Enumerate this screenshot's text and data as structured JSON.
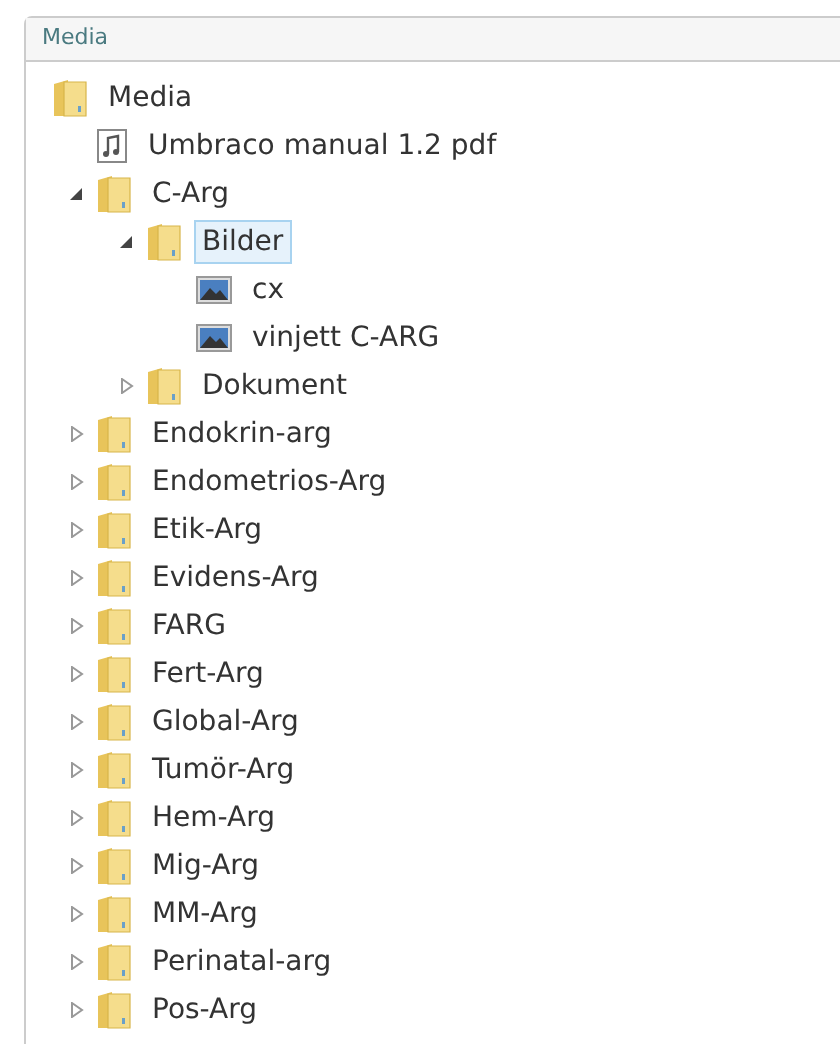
{
  "panel": {
    "title": "Media"
  },
  "tree": [
    {
      "label": "Media",
      "kind": "folder",
      "selected": false,
      "children": [
        {
          "label": "Umbraco manual 1.2 pdf",
          "kind": "document",
          "selected": false
        },
        {
          "label": "C-Arg",
          "kind": "folder",
          "selected": false,
          "expanded": true,
          "children": [
            {
              "label": "Bilder",
              "kind": "folder",
              "selected": true,
              "expanded": true,
              "children": [
                {
                  "label": "cx",
                  "kind": "image",
                  "selected": false
                },
                {
                  "label": "vinjett C-ARG",
                  "kind": "image",
                  "selected": false
                }
              ]
            },
            {
              "label": "Dokument",
              "kind": "folder",
              "selected": false,
              "expanded": false
            }
          ]
        },
        {
          "label": "Endokrin-arg",
          "kind": "folder",
          "selected": false,
          "expanded": false
        },
        {
          "label": "Endometrios-Arg",
          "kind": "folder",
          "selected": false,
          "expanded": false
        },
        {
          "label": "Etik-Arg",
          "kind": "folder",
          "selected": false,
          "expanded": false
        },
        {
          "label": "Evidens-Arg",
          "kind": "folder",
          "selected": false,
          "expanded": false
        },
        {
          "label": "FARG",
          "kind": "folder",
          "selected": false,
          "expanded": false
        },
        {
          "label": "Fert-Arg",
          "kind": "folder",
          "selected": false,
          "expanded": false
        },
        {
          "label": "Global-Arg",
          "kind": "folder",
          "selected": false,
          "expanded": false
        },
        {
          "label": "Tumör-Arg",
          "kind": "folder",
          "selected": false,
          "expanded": false
        },
        {
          "label": "Hem-Arg",
          "kind": "folder",
          "selected": false,
          "expanded": false
        },
        {
          "label": "Mig-Arg",
          "kind": "folder",
          "selected": false,
          "expanded": false
        },
        {
          "label": "MM-Arg",
          "kind": "folder",
          "selected": false,
          "expanded": false
        },
        {
          "label": "Perinatal-arg",
          "kind": "folder",
          "selected": false,
          "expanded": false
        },
        {
          "label": "Pos-Arg",
          "kind": "folder",
          "selected": false,
          "expanded": false
        }
      ]
    }
  ]
}
